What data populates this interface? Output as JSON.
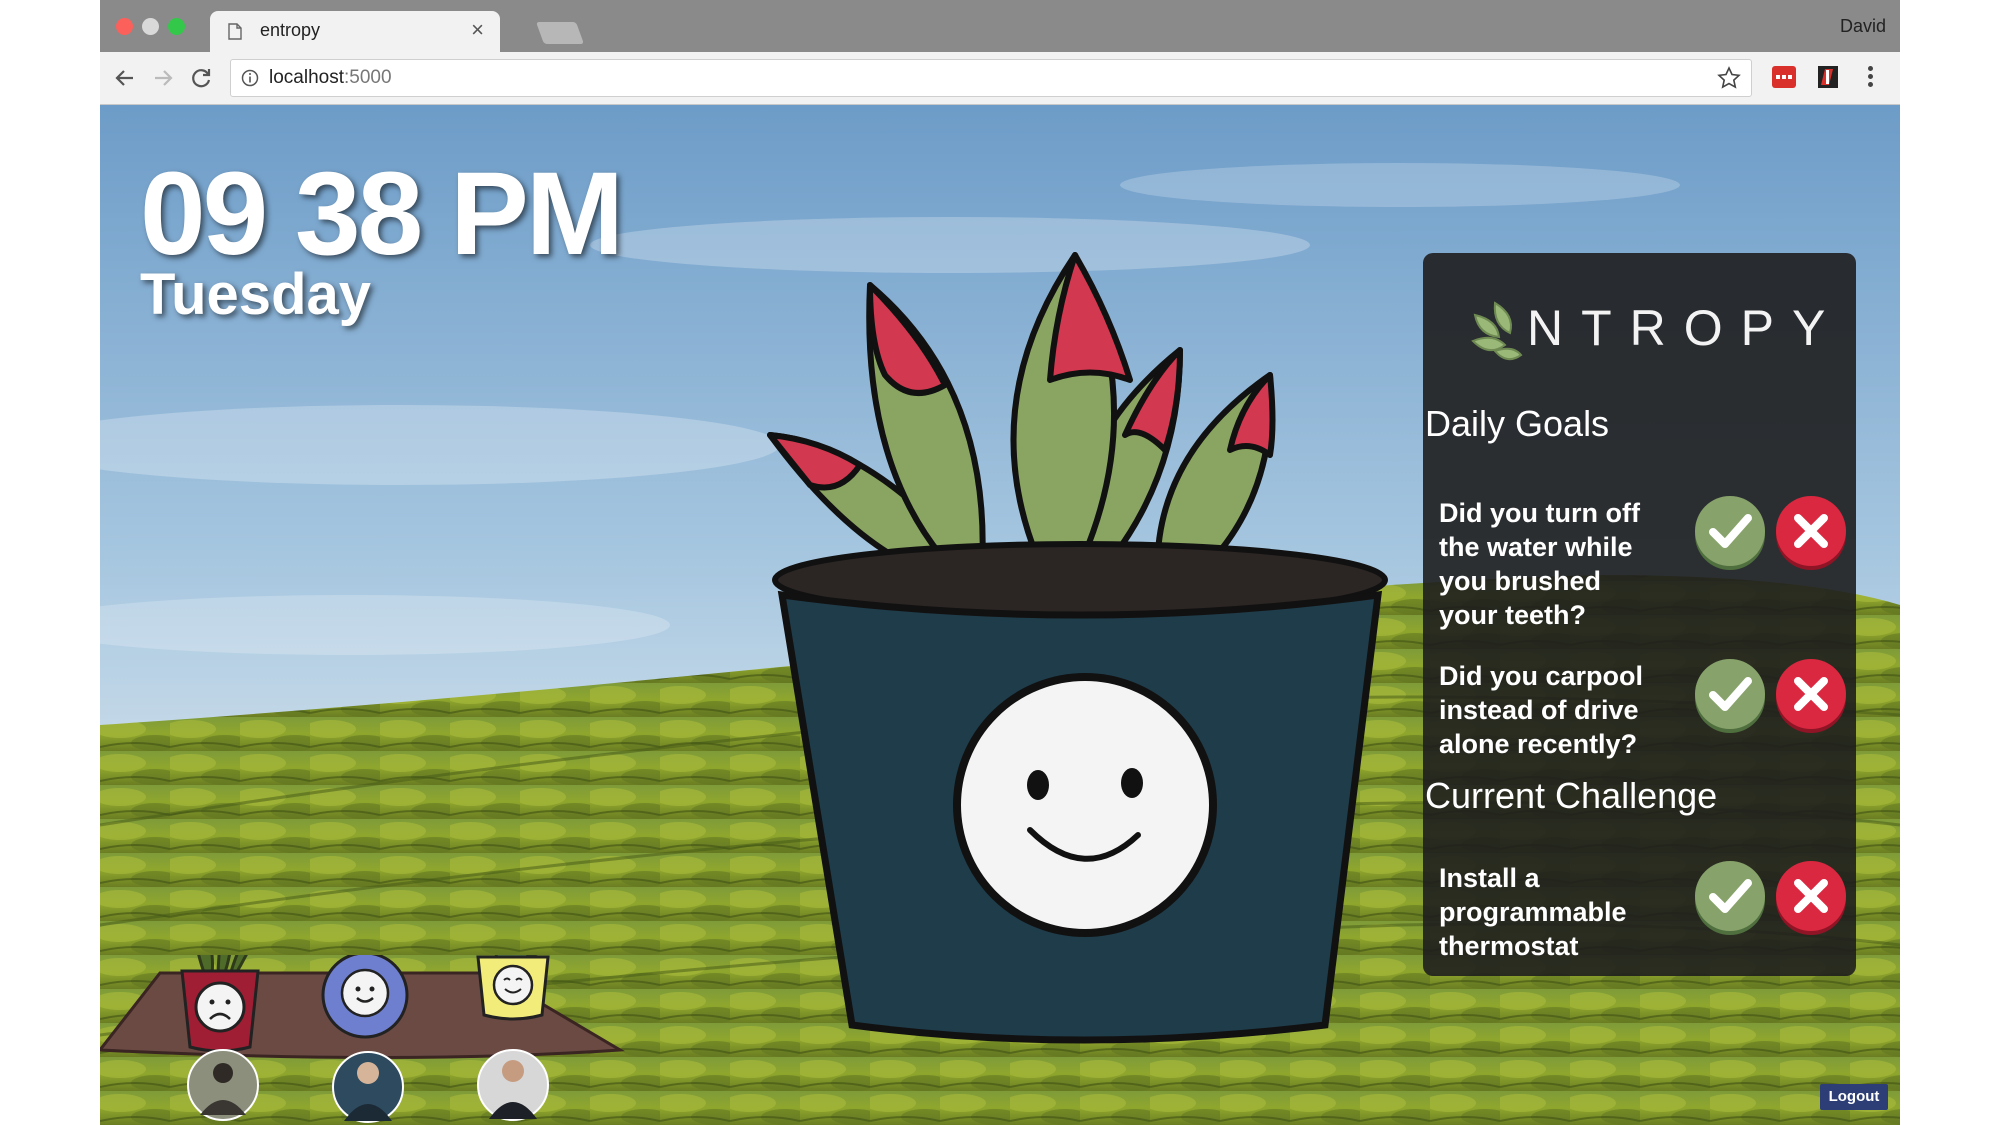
{
  "browser": {
    "tab_title": "entropy",
    "tab_close": "×",
    "profile_name": "David",
    "url_host": "localhost",
    "url_port": ":5000"
  },
  "clock": {
    "time": "09 38 PM",
    "day": "Tuesday"
  },
  "panel": {
    "logo_text": "NTROPY",
    "daily_goals_title": "Daily Goals",
    "goals": [
      {
        "text": "Did you turn off the water while you brushed your teeth?"
      },
      {
        "text": "Did you carpool instead of drive alone recently?"
      }
    ],
    "current_challenge_title": "Current Challenge",
    "challenge": {
      "text": "Install a programmable thermostat"
    }
  },
  "footer": {
    "logout_label": "Logout"
  },
  "colors": {
    "panel_bg": "#1e1e1e",
    "yes_button": "#87a26a",
    "no_button": "#d9283f",
    "pot": "#1f3c4a",
    "logout_button": "#2d3e77"
  },
  "friends": [
    {
      "plant_mood": "sad",
      "pot_color": "#a01e34"
    },
    {
      "plant_mood": "happy",
      "pot_color": "#6e7fd0"
    },
    {
      "plant_mood": "content",
      "pot_color": "#f2ec7a"
    }
  ]
}
